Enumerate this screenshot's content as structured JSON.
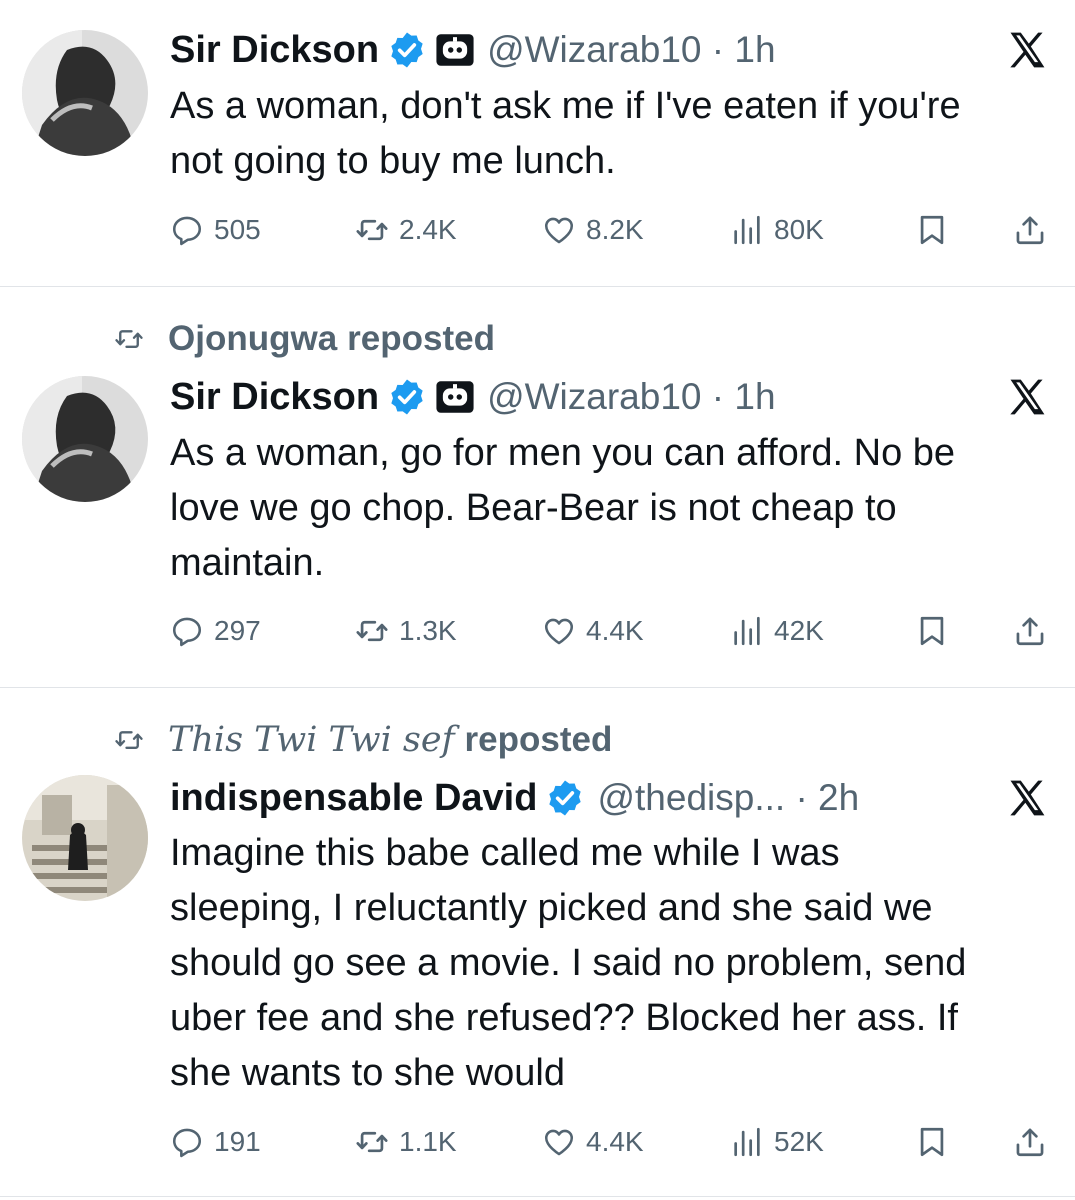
{
  "tweets": [
    {
      "repost_by": "",
      "repost_suffix": "",
      "author": "Sir Dickson",
      "verified": true,
      "bot_badge": "robot-badge-icon",
      "handle_time": "@Wizarab10 · 1h",
      "lines": [
        "As a woman, don't ask me if I've eaten if you're",
        "not going to buy me lunch."
      ],
      "stats": {
        "replies": "505",
        "reposts": "2.4K",
        "likes": "8.2K",
        "views": "80K"
      }
    },
    {
      "repost_by": "Ojonugwa",
      "repost_suffix": "reposted",
      "author": "Sir Dickson",
      "verified": true,
      "bot_badge": "robot-badge-icon",
      "handle_time": "@Wizarab10 · 1h",
      "lines": [
        "As a woman, go for men you can afford. No be",
        "love we go chop. Bear-Bear is not cheap to",
        "maintain."
      ],
      "stats": {
        "replies": "297",
        "reposts": "1.3K",
        "likes": "4.4K",
        "views": "42K"
      }
    },
    {
      "repost_by": "This Twi Twi sef",
      "repost_suffix": "reposted",
      "author": "indispensable David",
      "verified": true,
      "handle_time": "@thedisp... · 2h",
      "lines": [
        "Imagine this babe called me while I was",
        "sleeping, I reluctantly picked and she said we",
        "should go see a movie. I said no problem, send",
        "uber fee and she refused?? Blocked her ass. If",
        "she wants to she would"
      ],
      "stats": {
        "replies": "191",
        "reposts": "1.1K",
        "likes": "4.4K",
        "views": "52K"
      }
    }
  ],
  "colors": {
    "text": "#0f1419",
    "secondary": "#536471",
    "verified": "#1d9bf0",
    "divider": "#e1e4e8"
  }
}
